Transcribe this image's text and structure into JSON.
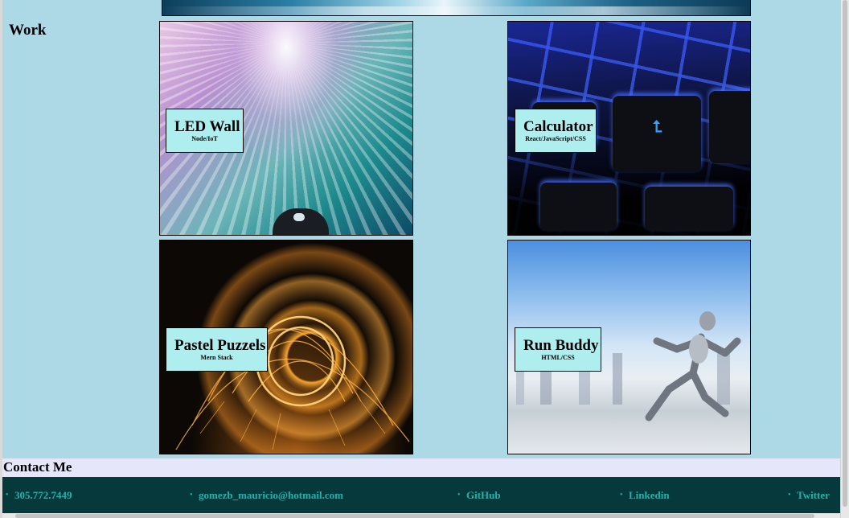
{
  "work": {
    "title": "Work",
    "projects": [
      {
        "title": "LED Wall",
        "tech": "Node/IoT",
        "image": "led-fiber-optic-image"
      },
      {
        "title": "Calculator",
        "tech": "React/JavaScript/CSS",
        "image": "keyboard-image"
      },
      {
        "title": "Pastel Puzzels",
        "tech": "Mern Stack",
        "image": "steel-wool-sparks-image"
      },
      {
        "title": "Run Buddy",
        "tech": "HTML/CSS",
        "image": "running-robot-image"
      }
    ]
  },
  "contact": {
    "title": "Contact Me",
    "links": [
      {
        "label": "305.772.7449"
      },
      {
        "label": "gomezb_mauricio@hotmail.com"
      },
      {
        "label": "GitHub"
      },
      {
        "label": "Linkedin"
      },
      {
        "label": "Twitter"
      }
    ]
  },
  "colors": {
    "work_background": "#add8e6",
    "card_label_background": "#afeeee",
    "contact_band_background": "#e6e6fa",
    "footer_background": "#05393c",
    "footer_link_color": "#20b2aa"
  }
}
